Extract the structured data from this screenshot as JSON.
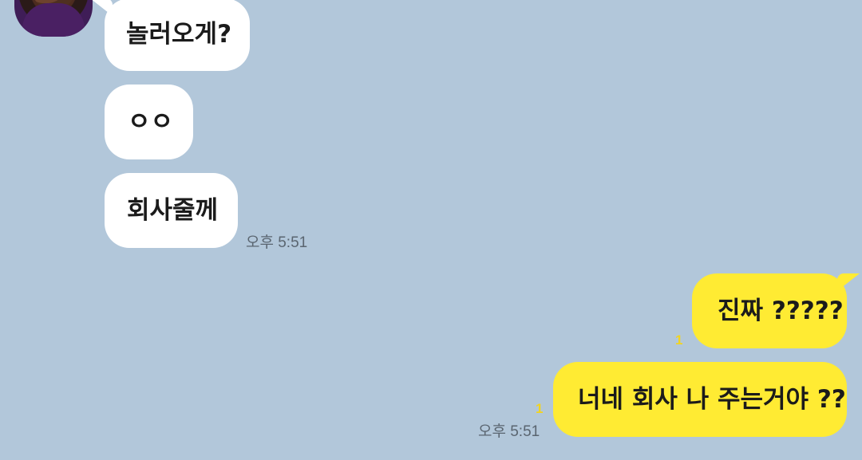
{
  "chat": {
    "incoming": [
      {
        "text": "놀러오게?"
      },
      {
        "text": "ㅇㅇ"
      },
      {
        "text": "회사줄께"
      }
    ],
    "incoming_time": "오후 5:51",
    "outgoing": [
      {
        "text": "진짜 ?????",
        "read_count": "1"
      },
      {
        "text": "너네 회사 나 주는거야 ??",
        "read_count": "1"
      }
    ],
    "outgoing_time": "오후 5:51"
  },
  "colors": {
    "background": "#b2c7da",
    "incoming_bubble": "#ffffff",
    "outgoing_bubble": "#ffeb33",
    "read_count": "#f2d41f",
    "time_text": "#5a6570"
  },
  "icons": {
    "avatar": "profile-avatar"
  }
}
